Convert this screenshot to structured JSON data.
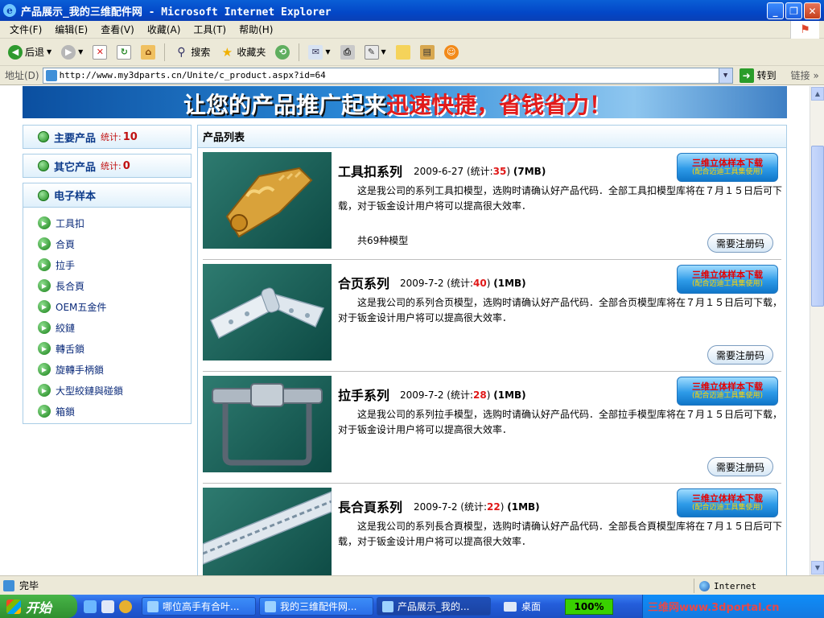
{
  "window": {
    "title": "产品展示_我的三维配件网 - Microsoft Internet Explorer",
    "controls": [
      "_",
      "❐",
      "✕"
    ]
  },
  "menu": [
    "文件(F)",
    "编辑(E)",
    "查看(V)",
    "收藏(A)",
    "工具(T)",
    "帮助(H)"
  ],
  "toolbar": {
    "back": "后退",
    "search": "搜索",
    "favorites": "收藏夹"
  },
  "address": {
    "label": "地址(D)",
    "url": "http://www.my3dparts.cn/Unite/c_product.aspx?id=64",
    "go": "转到",
    "links": "链接"
  },
  "banner": {
    "text_white": "让您的产品推广起来",
    "text_red": "迅速快捷，省钱省力！"
  },
  "sidebar": {
    "main_products": {
      "name": "主要产品",
      "stat_label": "统计:",
      "stat_value": "10"
    },
    "other_products": {
      "name": "其它产品",
      "stat_label": "统计:",
      "stat_value": "0"
    },
    "samples": {
      "name": "电子样本",
      "items": [
        "工具扣",
        "合頁",
        "拉手",
        "長合頁",
        "OEM五金件",
        "絞鏈",
        "轉舌鎖",
        "旋轉手柄鎖",
        "大型絞鏈與碰鎖",
        "箱鎖"
      ]
    }
  },
  "product_list": {
    "header": "产品列表",
    "download_label_1": "三维立体样本下载",
    "download_label_2": "(配合迈迪工具集使用)",
    "register_label": "需要注册码",
    "products": [
      {
        "name": "工具扣系列",
        "date": "2009-6-27",
        "stat_prefix": "(统计:",
        "count": "35",
        "stat_suffix": ")",
        "size": "(7MB)",
        "desc": "这是我公司的系列工具扣模型，选购时请确认好产品代码．全部工具扣模型库将在７月１５日后可下载，对于钣金设计用户将可以提高很大效率．",
        "models": "共69种模型"
      },
      {
        "name": "合页系列",
        "date": "2009-7-2",
        "stat_prefix": "(统计:",
        "count": "40",
        "stat_suffix": ")",
        "size": "(1MB)",
        "desc": "这是我公司的系列合页模型，选购时请确认好产品代码．全部合页模型库将在７月１５日后可下载，对于钣金设计用户将可以提高很大效率．"
      },
      {
        "name": "拉手系列",
        "date": "2009-7-2",
        "stat_prefix": "(统计:",
        "count": "28",
        "stat_suffix": ")",
        "size": "(1MB)",
        "desc": "这是我公司的系列拉手模型，选购时请确认好产品代码．全部拉手模型库将在７月１５日后可下载，对于钣金设计用户将可以提高很大效率．"
      },
      {
        "name": "長合頁系列",
        "date": "2009-7-2",
        "stat_prefix": "(统计:",
        "count": "22",
        "stat_suffix": ")",
        "size": "(1MB)",
        "desc": "这是我公司的系列長合頁模型，选购时请确认好产品代码．全部長合頁模型库将在７月１５日后可下载，对于钣金设计用户将可以提高很大效率．"
      }
    ]
  },
  "status": {
    "text": "完毕",
    "zone": "Internet"
  },
  "taskbar": {
    "start": "开始",
    "tasks": [
      "哪位高手有合叶...",
      "我的三维配件网...",
      "产品展示_我的..."
    ],
    "desktop": "桌面",
    "zoom": "100%",
    "tray_text": "三维网www.3dportal.cn"
  }
}
